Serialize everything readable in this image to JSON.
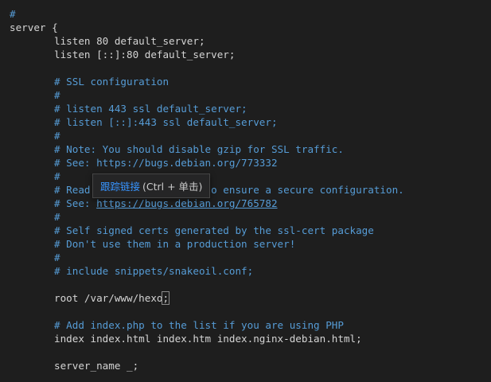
{
  "editor": {
    "lines": [
      {
        "kind": "comment",
        "text": "#"
      },
      {
        "kind": "code",
        "text": "server {"
      },
      {
        "kind": "code-indent",
        "text": "listen 80 default_server;"
      },
      {
        "kind": "code-indent",
        "text": "listen [::]:80 default_server;"
      },
      {
        "kind": "blank",
        "text": ""
      },
      {
        "kind": "comment-indent",
        "text": "# SSL configuration"
      },
      {
        "kind": "comment-indent",
        "text": "#"
      },
      {
        "kind": "comment-indent",
        "text": "# listen 443 ssl default_server;"
      },
      {
        "kind": "comment-indent",
        "text": "# listen [::]:443 ssl default_server;"
      },
      {
        "kind": "comment-indent",
        "text": "#"
      },
      {
        "kind": "comment-indent",
        "text": "# Note: You should disable gzip for SSL traffic."
      },
      {
        "kind": "comment-indent",
        "text": "# See: https://bugs.debian.org/773332"
      },
      {
        "kind": "comment-indent",
        "text": "#"
      },
      {
        "kind": "comment-indent",
        "text": "# Read up on ssl_ciphers to ensure a secure configuration."
      },
      {
        "kind": "link-line",
        "prefix": "# See: ",
        "link": "https://bugs.debian.org/765782"
      },
      {
        "kind": "comment-indent",
        "text": "#"
      },
      {
        "kind": "comment-indent",
        "text": "# Self signed certs generated by the ssl-cert package"
      },
      {
        "kind": "comment-indent",
        "text": "# Don't use them in a production server!"
      },
      {
        "kind": "comment-indent",
        "text": "#"
      },
      {
        "kind": "comment-indent",
        "text": "# include snippets/snakeoil.conf;"
      },
      {
        "kind": "blank",
        "text": ""
      },
      {
        "kind": "cursor-line",
        "text": "root /var/www/hexo",
        "after_cursor": ";"
      },
      {
        "kind": "blank",
        "text": ""
      },
      {
        "kind": "comment-indent",
        "text": "# Add index.php to the list if you are using PHP"
      },
      {
        "kind": "code-indent",
        "text": "index index.html index.htm index.nginx-debian.html;"
      },
      {
        "kind": "blank",
        "text": ""
      },
      {
        "kind": "code-indent",
        "text": "server_name _;"
      }
    ]
  },
  "tooltip": {
    "action_label": "跟踪链接",
    "shortcut_label": "(Ctrl + 单击)"
  },
  "colors": {
    "background": "#1e1e1e",
    "comment": "#569cd6",
    "text": "#d4d4d4",
    "tooltip_bg": "#252526",
    "tooltip_link": "#3794ff"
  }
}
